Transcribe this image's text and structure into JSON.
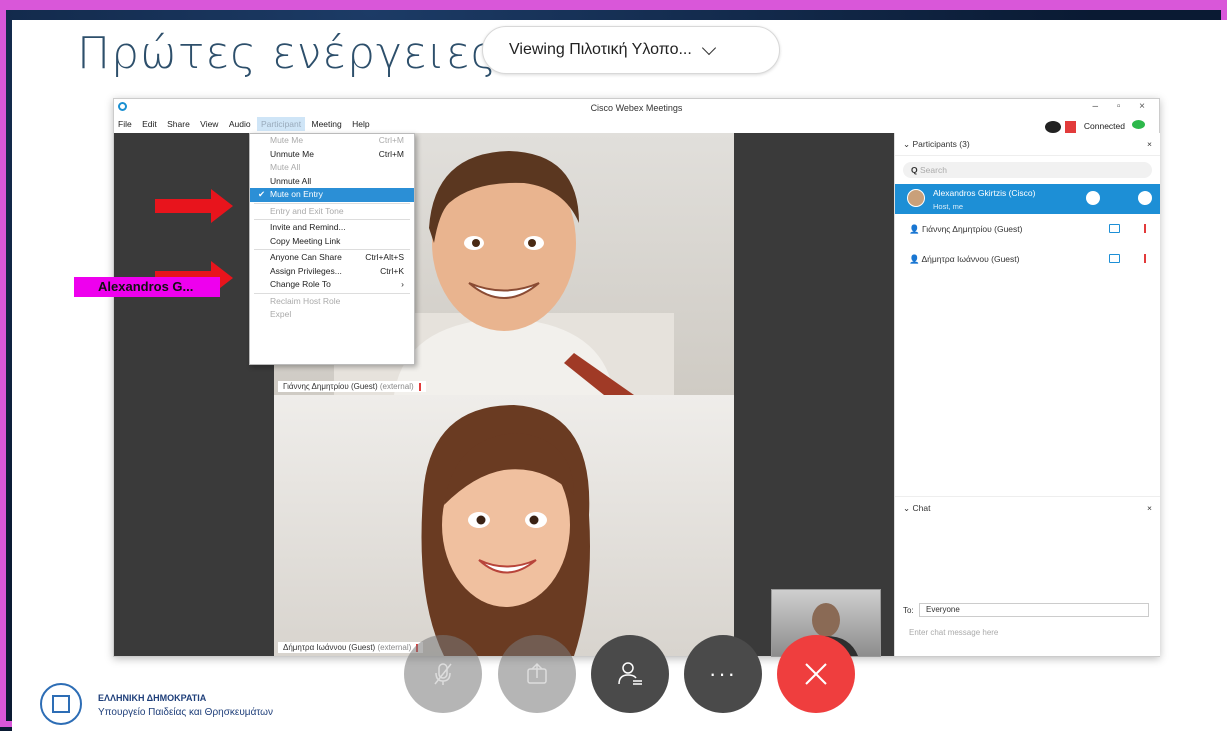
{
  "slide": {
    "title": "Πρώτες ενέργειες (",
    "viewing": "Viewing Πιλοτική Υλοπο..."
  },
  "webex": {
    "window_title": "Cisco Webex Meetings",
    "connection_status": "Connected",
    "menu": [
      "File",
      "Edit",
      "Share",
      "View",
      "Audio",
      "Participant",
      "Meeting",
      "Help"
    ],
    "dropdown": [
      {
        "label": "Mute Me",
        "shortcut": "Ctrl+M",
        "state": "disabled"
      },
      {
        "label": "Unmute Me",
        "shortcut": "Ctrl+M",
        "state": "normal"
      },
      {
        "label": "Mute All",
        "shortcut": "",
        "state": "disabled"
      },
      {
        "label": "Unmute All",
        "shortcut": "",
        "state": "normal"
      },
      {
        "label": "Mute on Entry",
        "shortcut": "",
        "state": "selected",
        "checked": true
      },
      {
        "label": "Entry and Exit Tone",
        "shortcut": "",
        "state": "disabled"
      },
      {
        "label": "Invite and Remind...",
        "shortcut": "",
        "state": "normal"
      },
      {
        "label": "Copy Meeting Link",
        "shortcut": "",
        "state": "normal"
      },
      {
        "label": "Anyone Can Share",
        "shortcut": "Ctrl+Alt+S",
        "state": "normal"
      },
      {
        "label": "Assign Privileges...",
        "shortcut": "Ctrl+K",
        "state": "normal"
      },
      {
        "label": "Change Role To",
        "shortcut": "›",
        "state": "normal"
      },
      {
        "label": "Reclaim Host Role",
        "shortcut": "",
        "state": "disabled"
      },
      {
        "label": "Expel",
        "shortcut": "",
        "state": "disabled"
      }
    ],
    "videos": [
      {
        "name": "Γιάννης Δημητρίου (Guest)",
        "suffix": "(external)"
      },
      {
        "name": "Δήμητρα Ιωάννου (Guest)",
        "suffix": "(external)"
      }
    ],
    "participants": {
      "header": "Participants (3)",
      "search_placeholder": "Search",
      "list": [
        {
          "name": "Alexandros Gkirtzis (Cisco)",
          "sub": "Host, me"
        },
        {
          "name": "Γιάννης Δημητρίου (Guest)"
        },
        {
          "name": "Δήμητρα Ιωάννου (Guest)"
        }
      ]
    },
    "chat": {
      "header": "Chat",
      "to_label": "To:",
      "to_value": "Everyone",
      "input_placeholder": "Enter chat message here"
    }
  },
  "annotation": {
    "name_tag": "Alexandros G..."
  },
  "controls": [
    {
      "name": "mute",
      "icon": "mic-off-icon"
    },
    {
      "name": "share",
      "icon": "share-icon"
    },
    {
      "name": "participants",
      "icon": "participants-icon"
    },
    {
      "name": "more",
      "icon": "more-icon"
    },
    {
      "name": "leave",
      "icon": "close-icon"
    }
  ],
  "footer": {
    "org_line1": "ΕΛΛΗΝΙΚΗ ΔΗΜΟΚΡΑΤΙΑ",
    "org_line2": "Υπουργείο Παιδείας και Θρησκευμάτων"
  },
  "colors": {
    "frame": "#d957d9",
    "accent": "#1d8fd6",
    "arrow": "#e8141c",
    "name_tag": "#ee00ee",
    "leave": "#ef3e3e"
  }
}
